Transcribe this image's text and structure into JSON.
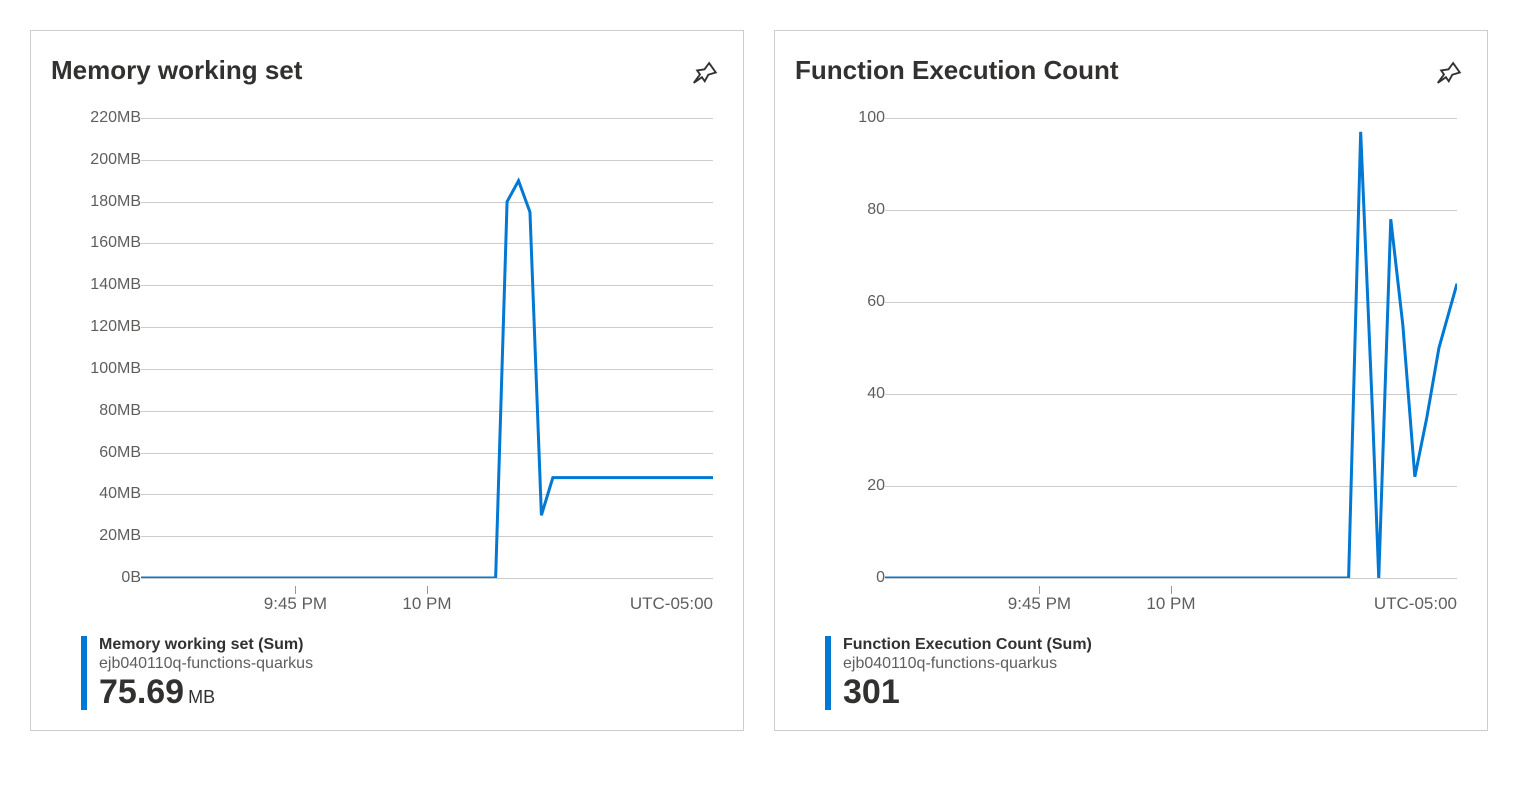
{
  "charts": [
    {
      "title": "Memory working set",
      "timezone": "UTC-05:00",
      "legend": {
        "title": "Memory working set (Sum)",
        "sub": "ejb040110q-functions-quarkus",
        "value": "75.69",
        "unit": "MB"
      }
    },
    {
      "title": "Function Execution Count",
      "timezone": "UTC-05:00",
      "legend": {
        "title": "Function Execution Count (Sum)",
        "sub": "ejb040110q-functions-quarkus",
        "value": "301",
        "unit": ""
      }
    }
  ],
  "chart_data": [
    {
      "type": "line",
      "title": "Memory working set",
      "xlabel": "",
      "ylabel": "",
      "x_tick_labels": [
        "9:45 PM",
        "10 PM"
      ],
      "timezone": "UTC-05:00",
      "ylim": [
        0,
        220
      ],
      "y_ticks": [
        0,
        20,
        40,
        60,
        80,
        100,
        120,
        140,
        160,
        180,
        200,
        220
      ],
      "y_tick_labels": [
        "0B",
        "20MB",
        "40MB",
        "60MB",
        "80MB",
        "100MB",
        "120MB",
        "140MB",
        "160MB",
        "180MB",
        "200MB",
        "220MB"
      ],
      "series": [
        {
          "name": "Memory working set (Sum)",
          "resource": "ejb040110q-functions-quarkus",
          "x": [
            0,
            5,
            10,
            15,
            20,
            25,
            30,
            35,
            40,
            45,
            50,
            55,
            60,
            62,
            64,
            66,
            68,
            70,
            72,
            75,
            80,
            85,
            90,
            100
          ],
          "values": [
            0,
            0,
            0,
            0,
            0,
            0,
            0,
            0,
            0,
            0,
            0,
            0,
            0,
            0,
            180,
            190,
            175,
            30,
            48,
            48,
            48,
            48,
            48,
            48
          ]
        }
      ],
      "summary_value": 75.69,
      "summary_unit": "MB"
    },
    {
      "type": "line",
      "title": "Function Execution Count",
      "xlabel": "",
      "ylabel": "",
      "x_tick_labels": [
        "9:45 PM",
        "10 PM"
      ],
      "timezone": "UTC-05:00",
      "ylim": [
        0,
        100
      ],
      "y_ticks": [
        0,
        20,
        40,
        60,
        80,
        100
      ],
      "y_tick_labels": [
        "0",
        "20",
        "40",
        "60",
        "80",
        "100"
      ],
      "series": [
        {
          "name": "Function Execution Count (Sum)",
          "resource": "ejb040110q-functions-quarkus",
          "x": [
            0,
            10,
            20,
            30,
            40,
            50,
            60,
            70,
            75,
            77,
            79,
            81,
            82,
            84,
            86,
            88,
            90,
            92,
            95
          ],
          "values": [
            0,
            0,
            0,
            0,
            0,
            0,
            0,
            0,
            0,
            0,
            97,
            35,
            0,
            78,
            55,
            22,
            35,
            50,
            64
          ]
        }
      ],
      "summary_value": 301,
      "summary_unit": ""
    }
  ]
}
